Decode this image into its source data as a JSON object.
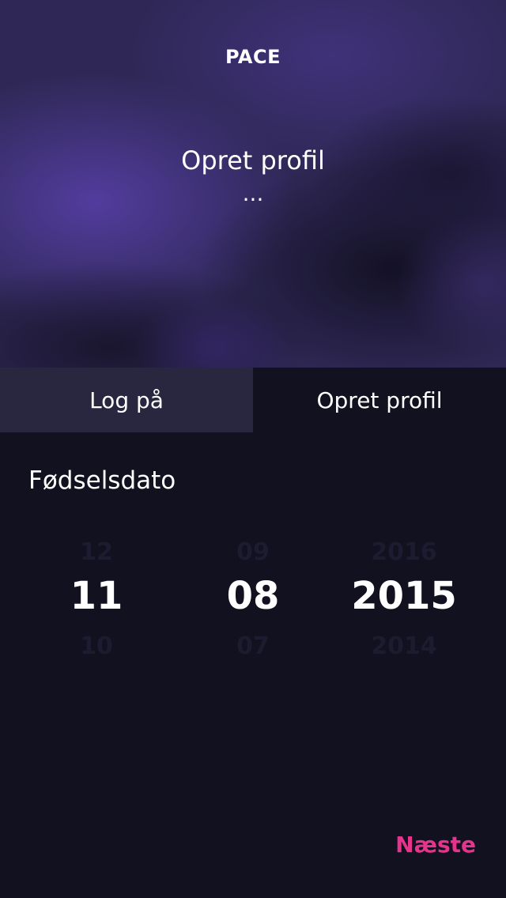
{
  "header": {
    "logo": "PACE",
    "title": "Opret profil",
    "ellipsis": "..."
  },
  "tabs": [
    {
      "label": "Log på",
      "active": false
    },
    {
      "label": "Opret profil",
      "active": true
    }
  ],
  "form": {
    "birthdate_label": "Fødselsdato"
  },
  "picker": {
    "day": {
      "prev": "12",
      "current": "11",
      "next": "10"
    },
    "month": {
      "prev": "09",
      "current": "08",
      "next": "07"
    },
    "year": {
      "prev": "2016",
      "current": "2015",
      "next": "2014"
    }
  },
  "actions": {
    "next_label": "Næste"
  },
  "colors": {
    "accent": "#e8338d",
    "background": "#12111f",
    "tab_inactive": "#29273f",
    "hero": "#2f2856"
  }
}
